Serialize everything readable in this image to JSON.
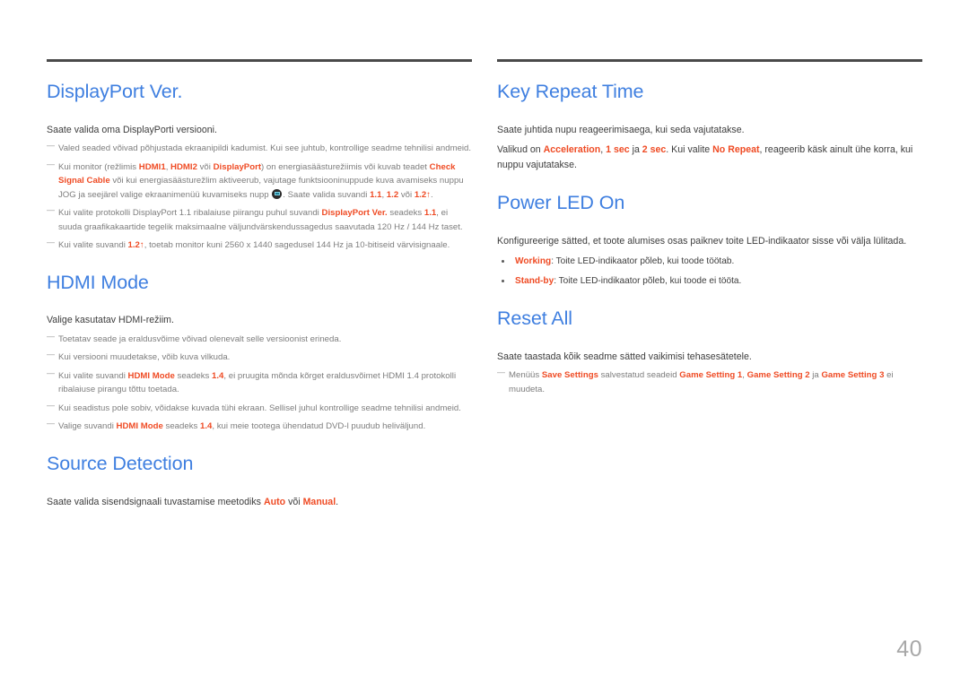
{
  "page": {
    "number": "40",
    "language": "et"
  },
  "left_column": {
    "sections": [
      {
        "id": "displayport-ver",
        "title": "DisplayPort Ver.",
        "lead": "Saate valida oma DisplayPorti versiooni.",
        "notes": [
          {
            "id": "note-wrong-settings",
            "parts": [
              {
                "text": "Valed seaded võivad põhjustada ekraanipildi kadumist. Kui see juhtub, kontrollige seadme tehnilisi andmeid.",
                "style": "plain"
              }
            ]
          },
          {
            "id": "note-power-saving",
            "parts": [
              {
                "text": "Kui monitor (režlimis ",
                "style": "plain"
              },
              {
                "text": "HDMI1",
                "style": "highlight"
              },
              {
                "text": ", ",
                "style": "plain"
              },
              {
                "text": "HDMI2",
                "style": "highlight"
              },
              {
                "text": " või ",
                "style": "plain"
              },
              {
                "text": "DisplayPort",
                "style": "highlight"
              },
              {
                "text": ") on energiasäästurežiimis või kuvab teadet ",
                "style": "plain"
              },
              {
                "text": "Check Signal Cable",
                "style": "highlight"
              },
              {
                "text": " või kui energiasäästurežlim aktiveerub, vajutage funktsiooninuppude kuva avamiseks nuppu JOG ja seejärel valige ekraanimenüü kuvamiseks nupp ",
                "style": "plain"
              },
              {
                "text": "",
                "style": "icon",
                "icon": "jog-menu-icon"
              },
              {
                "text": ". Saate valida suvandi ",
                "style": "plain"
              },
              {
                "text": "1.1",
                "style": "highlight"
              },
              {
                "text": ", ",
                "style": "plain"
              },
              {
                "text": "1.2",
                "style": "highlight"
              },
              {
                "text": " või ",
                "style": "plain"
              },
              {
                "text": "1.2↑",
                "style": "highlight"
              },
              {
                "text": ".",
                "style": "plain"
              }
            ]
          },
          {
            "id": "note-dp11-bandwidth",
            "parts": [
              {
                "text": "Kui valite protokolli DisplayPort 1.1 ribalaiuse piirangu puhul suvandi ",
                "style": "plain"
              },
              {
                "text": "DisplayPort Ver.",
                "style": "highlight"
              },
              {
                "text": " seadeks ",
                "style": "plain"
              },
              {
                "text": "1.1",
                "style": "highlight"
              },
              {
                "text": ", ei suuda graafikakaartide tegelik maksimaalne väljundvärskendussagedus saavutada 120 Hz / 144 Hz taset.",
                "style": "plain"
              }
            ]
          },
          {
            "id": "note-dp12-support",
            "parts": [
              {
                "text": "Kui valite suvandi ",
                "style": "plain"
              },
              {
                "text": "1.2↑",
                "style": "highlight"
              },
              {
                "text": ", toetab monitor kuni 2560 x 1440 sagedusel 144 Hz ja 10-bitiseid värvisignaale.",
                "style": "plain"
              }
            ]
          }
        ]
      },
      {
        "id": "hdmi-mode",
        "title": "HDMI Mode",
        "lead": "Valige kasutatav HDMI-režiim.",
        "notes": [
          {
            "id": "note-device-resolution",
            "parts": [
              {
                "text": "Toetatav seade ja eraldusvõime võivad olenevalt selle versioonist erineda.",
                "style": "plain"
              }
            ]
          },
          {
            "id": "note-version-flicker",
            "parts": [
              {
                "text": "Kui versiooni muudetakse, võib kuva vilkuda.",
                "style": "plain"
              }
            ]
          },
          {
            "id": "note-hdmi14-limit",
            "parts": [
              {
                "text": "Kui valite suvandi ",
                "style": "plain"
              },
              {
                "text": "HDMI Mode",
                "style": "highlight"
              },
              {
                "text": " seadeks ",
                "style": "plain"
              },
              {
                "text": "1.4",
                "style": "highlight"
              },
              {
                "text": ", ei pruugita mõnda kõrget eraldusvõimet HDMI 1.4 protokolli ribalaiuse pirangu tõttu toetada.",
                "style": "plain"
              }
            ]
          },
          {
            "id": "note-blank-screen",
            "parts": [
              {
                "text": "Kui seadistus pole sobiv, võidakse kuvada tühi ekraan. Sellisel juhul kontrollige seadme tehnilisi andmeid.",
                "style": "plain"
              }
            ]
          },
          {
            "id": "note-dvd-audio",
            "parts": [
              {
                "text": "Valige suvandi ",
                "style": "plain"
              },
              {
                "text": "HDMI Mode",
                "style": "highlight"
              },
              {
                "text": " seadeks ",
                "style": "plain"
              },
              {
                "text": "1.4",
                "style": "highlight"
              },
              {
                "text": ", kui meie tootega ühendatud DVD-l puudub heliväljund.",
                "style": "plain"
              }
            ]
          }
        ]
      },
      {
        "id": "source-detection",
        "title": "Source Detection",
        "lead_parts": [
          {
            "text": "Saate valida sisendsignaali tuvastamise meetodiks ",
            "style": "plain"
          },
          {
            "text": "Auto",
            "style": "highlight"
          },
          {
            "text": " või ",
            "style": "plain"
          },
          {
            "text": "Manual",
            "style": "highlight"
          },
          {
            "text": ".",
            "style": "plain"
          }
        ],
        "notes": []
      }
    ]
  },
  "right_column": {
    "sections": [
      {
        "id": "key-repeat-time",
        "title": "Key Repeat Time",
        "lead": "Saate juhtida nupu reageerimisaega, kui seda vajutatakse.",
        "body_parts": [
          {
            "text": "Valikud on ",
            "style": "plain"
          },
          {
            "text": "Acceleration",
            "style": "highlight"
          },
          {
            "text": ", ",
            "style": "plain"
          },
          {
            "text": "1 sec",
            "style": "highlight"
          },
          {
            "text": " ja ",
            "style": "plain"
          },
          {
            "text": "2 sec",
            "style": "highlight"
          },
          {
            "text": ". Kui valite ",
            "style": "plain"
          },
          {
            "text": "No Repeat",
            "style": "highlight"
          },
          {
            "text": ", reageerib käsk ainult ühe korra, kui nuppu vajutatakse.",
            "style": "plain"
          }
        ]
      },
      {
        "id": "power-led-on",
        "title": "Power LED On",
        "lead": "Konfigureerige sätted, et toote alumises osas paiknev toite LED-indikaator sisse või välja lülitada.",
        "bullets": [
          {
            "id": "bullet-working",
            "parts": [
              {
                "text": "Working",
                "style": "highlight"
              },
              {
                "text": ": Toite LED-indikaator põleb, kui toode töötab.",
                "style": "plain"
              }
            ]
          },
          {
            "id": "bullet-standby",
            "parts": [
              {
                "text": "Stand-by",
                "style": "highlight"
              },
              {
                "text": ": Toite LED-indikaator põleb, kui toode ei tööta.",
                "style": "plain"
              }
            ]
          }
        ]
      },
      {
        "id": "reset-all",
        "title": "Reset All",
        "lead": "Saate taastada kõik seadme sätted vaikimisi tehasesätetele.",
        "notes": [
          {
            "id": "note-save-settings",
            "parts": [
              {
                "text": "Menüüs ",
                "style": "plain"
              },
              {
                "text": "Save Settings",
                "style": "highlight"
              },
              {
                "text": " salvestatud seadeid ",
                "style": "plain"
              },
              {
                "text": "Game Setting 1",
                "style": "highlight"
              },
              {
                "text": ", ",
                "style": "plain"
              },
              {
                "text": "Game Setting 2",
                "style": "highlight"
              },
              {
                "text": " ja ",
                "style": "plain"
              },
              {
                "text": "Game Setting 3",
                "style": "highlight"
              },
              {
                "text": " ei muudeta.",
                "style": "plain"
              }
            ]
          }
        ]
      }
    ]
  },
  "colors": {
    "heading_blue": "#3f7fe0",
    "accent_orange": "#ef4b24",
    "body_text": "#3c3c3c",
    "note_text": "#7d7d7d",
    "rule": "#4a4a4a",
    "page_number": "#a8a8a8"
  }
}
